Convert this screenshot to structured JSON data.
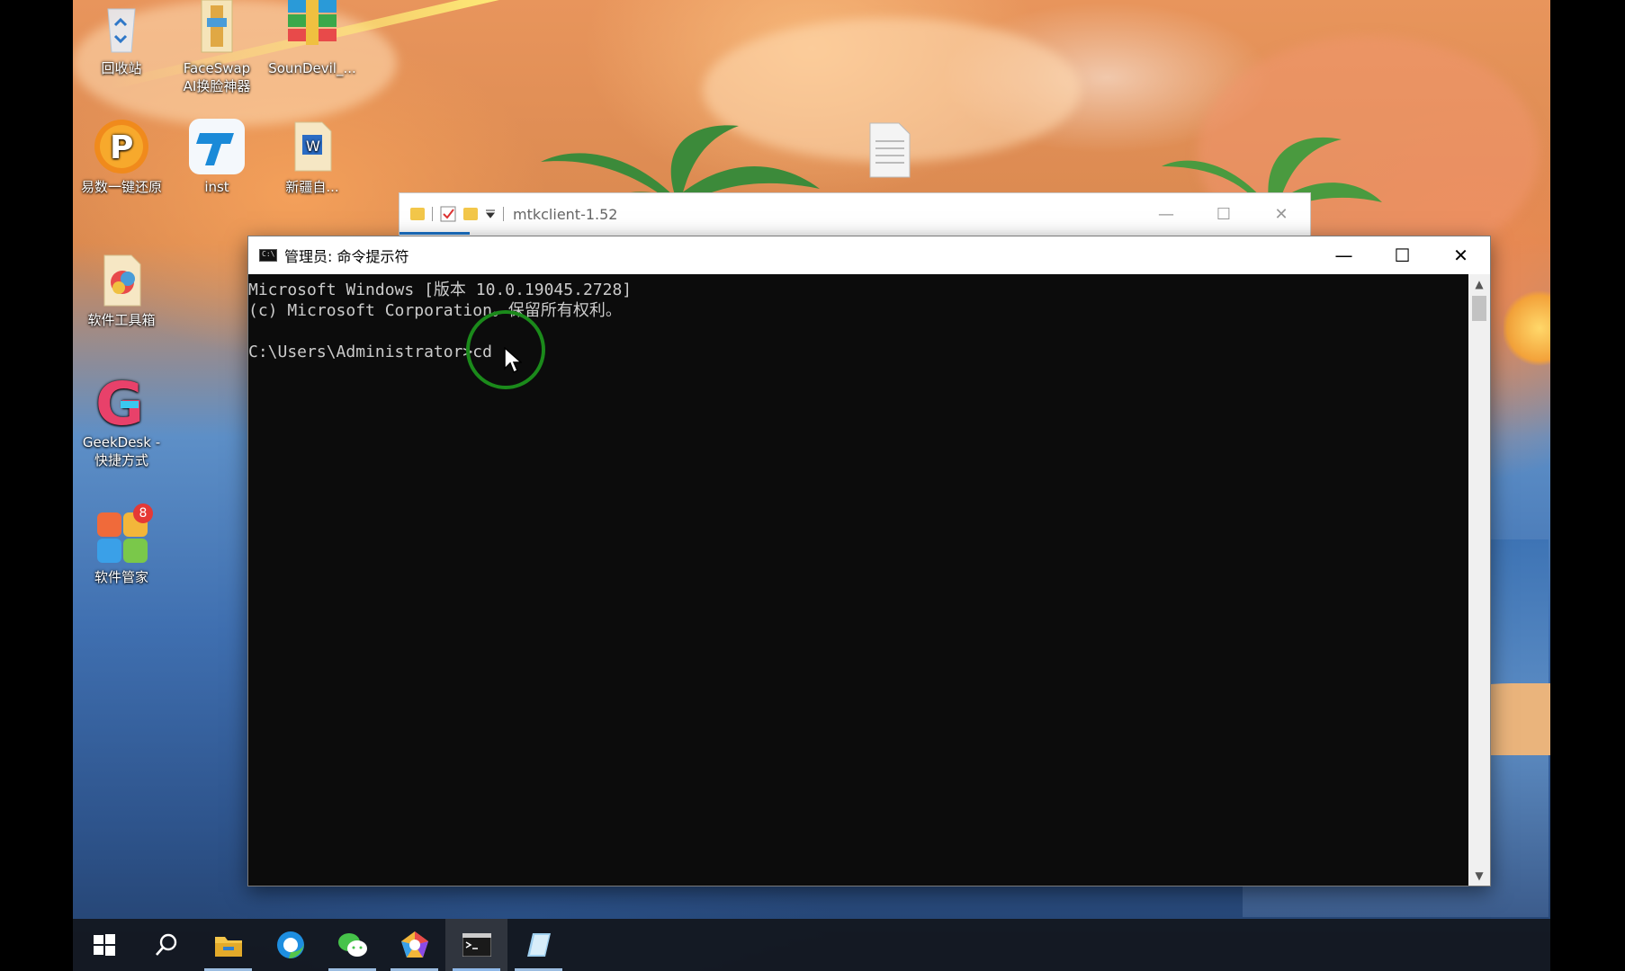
{
  "desktop": {
    "icons": [
      {
        "label": "回收站",
        "icon": "recycle-bin-icon"
      },
      {
        "label": "FaceSwap\nAI换脸神器",
        "icon": "faceswap-icon"
      },
      {
        "label": "SounDevil_...",
        "icon": "soundevil-icon"
      },
      {
        "label": "易数一键还原",
        "icon": "easy-restore-icon"
      },
      {
        "label": "inst",
        "icon": "inst-icon"
      },
      {
        "label": "新疆自...",
        "icon": "word-doc-icon"
      },
      {
        "label": "软件工具箱",
        "icon": "toolbox-icon"
      },
      {
        "label": "GeekDesk -\n快捷方式",
        "icon": "geekdesk-icon"
      },
      {
        "label": "软件管家",
        "icon": "software-manager-icon",
        "badge": "8"
      }
    ]
  },
  "explorer": {
    "title": "mtkclient-1.52"
  },
  "cmd": {
    "title": "管理员: 命令提示符",
    "icon_text": "C:\\",
    "lines": [
      "Microsoft Windows [版本 10.0.19045.2728]",
      "(c) Microsoft Corporation。保留所有权利。",
      "",
      "C:\\Users\\Administrator>cd"
    ]
  },
  "window_controls": {
    "minimize": "—",
    "maximize": "☐",
    "close": "✕"
  },
  "taskbar": {
    "items": [
      {
        "icon": "windows-start-icon"
      },
      {
        "icon": "search-icon"
      },
      {
        "icon": "file-explorer-icon"
      },
      {
        "icon": "edge-browser-icon"
      },
      {
        "icon": "wechat-icon"
      },
      {
        "icon": "colorful-app-icon"
      },
      {
        "icon": "cmd-icon"
      },
      {
        "icon": "notepad-icon"
      }
    ]
  },
  "colors": {
    "console_bg": "#0c0c0c",
    "console_text": "#cccccc",
    "cursor_highlight": "#1b8a1b"
  }
}
